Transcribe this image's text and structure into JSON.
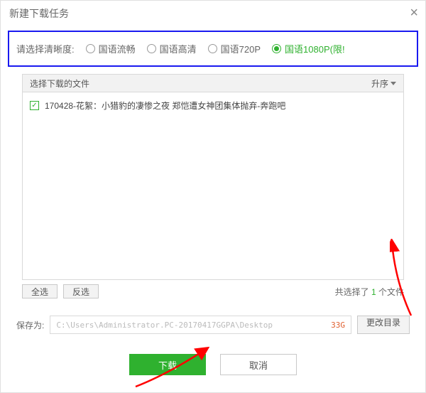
{
  "title": "新建下载任务",
  "quality": {
    "label": "请选择清晰度:",
    "options": [
      "国语流畅",
      "国语高清",
      "国语720P",
      "国语1080P(限!"
    ],
    "selected_index": 3
  },
  "list": {
    "header_left": "选择下载的文件",
    "header_right": "升序",
    "files": [
      {
        "checked": true,
        "name": "170428-花絮：小猎豹的凄惨之夜 郑恺遭女神团集体抛弃-奔跑吧"
      }
    ]
  },
  "selection": {
    "select_all": "全选",
    "invert": "反选",
    "info_prefix": "共选择了 ",
    "count": "1",
    "info_suffix": " 个文件"
  },
  "save": {
    "label": "保存为:",
    "path": "C:\\Users\\Administrator.PC-20170417GGPA\\Desktop",
    "free": "33G",
    "change_dir": "更改目录"
  },
  "actions": {
    "download": "下载",
    "cancel": "取消"
  }
}
